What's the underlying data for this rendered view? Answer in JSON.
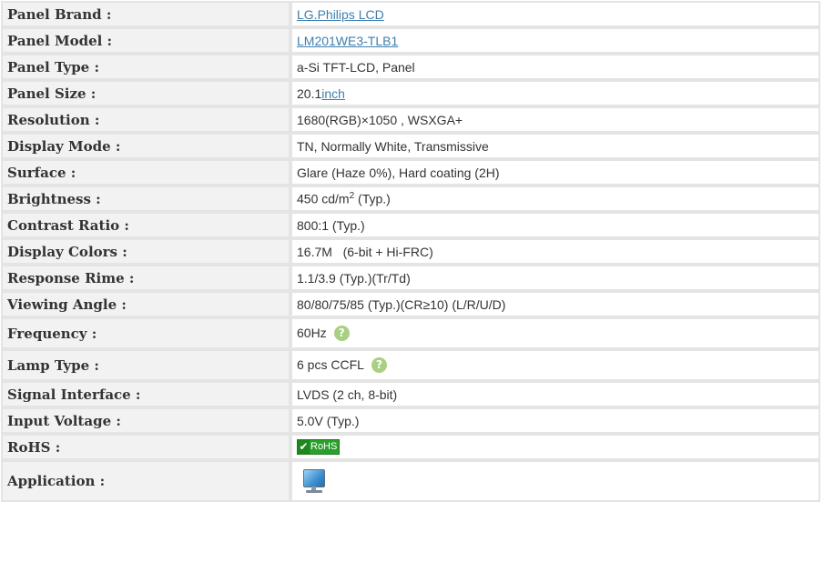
{
  "rows": [
    {
      "label": "Panel Brand :",
      "value": "LG.Philips LCD"
    },
    {
      "label": "Panel Model :",
      "value": "LM201WE3-TLB1"
    },
    {
      "label": "Panel Type :",
      "value": "a-Si TFT-LCD, Panel"
    },
    {
      "label": "Panel Size :",
      "value": "20.1",
      "unit_link": "inch"
    },
    {
      "label": "Resolution :",
      "value": "1680(RGB)×1050 , WSXGA+"
    },
    {
      "label": "Display Mode :",
      "value": "TN, Normally White, Transmissive"
    },
    {
      "label": "Surface :",
      "value": "Glare (Haze 0%), Hard coating (2H)"
    },
    {
      "label": "Brightness :",
      "value": "450",
      "unit": "cd/m",
      "sup": "2",
      "suffix": "(Typ.)"
    },
    {
      "label": "Contrast Ratio :",
      "value": "800:1 (Typ.)"
    },
    {
      "label": "Display Colors :",
      "value": "16.7M   (6-bit + Hi-FRC)"
    },
    {
      "label": "Response Rime :",
      "value": "1.1/3.9 (Typ.)(Tr/Td)"
    },
    {
      "label": "Viewing Angle :",
      "value": "80/80/75/85 (Typ.)(CR≥10) (L/R/U/D)"
    },
    {
      "label": "Frequency :",
      "value": "60Hz",
      "help": "?"
    },
    {
      "label": "Lamp Type :",
      "value": "6 pcs CCFL",
      "help": "?"
    },
    {
      "label": "Signal Interface :",
      "value": "LVDS (2 ch, 8-bit)"
    },
    {
      "label": "Input Voltage :",
      "value": "5.0V (Typ.)"
    },
    {
      "label": "RoHS :",
      "badge_check": "✔",
      "badge_text": "RoHS"
    },
    {
      "label": "Application :",
      "icon": "desktop-monitor-icon"
    }
  ],
  "colors": {
    "link": "#3f7fae",
    "label_bg": "#f2f2f2",
    "help_badge": "#a8cf82",
    "rohs_green": "#2c9e2c"
  }
}
